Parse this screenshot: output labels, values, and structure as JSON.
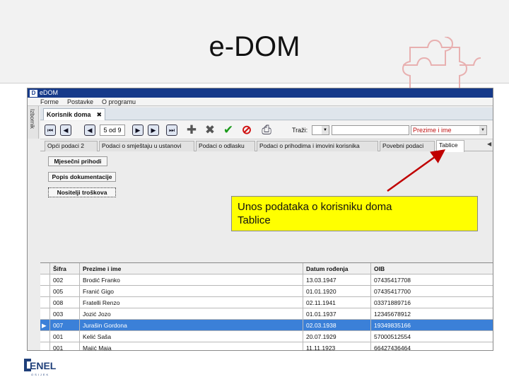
{
  "slide": {
    "title": "e-DOM"
  },
  "window": {
    "logo_letter": "D",
    "title": "eDOM"
  },
  "menu": [
    "Forme",
    "Postavke",
    "O programu"
  ],
  "left_strip_label": "Izbornik",
  "doc_tab": {
    "label": "Korisnik doma",
    "close": "✖"
  },
  "toolbar": {
    "record_counter": "5 od 9",
    "search_label": "Traži:",
    "sort_field": "Prezime i ime",
    "icons": {
      "first": "first-record-icon",
      "prev_page": "previous-page-icon",
      "prev": "previous-record-icon",
      "next": "next-record-icon",
      "next_page": "next-page-icon",
      "last": "last-record-icon",
      "add": "add-icon",
      "delete": "delete-icon",
      "save": "checkmark-icon",
      "cancel": "cancel-icon",
      "print": "printer-icon"
    },
    "glyphs": {
      "first": "⏮",
      "prev_page": "◀",
      "prev": "◀",
      "next": "▶",
      "next_page": "▶",
      "last": "⏭",
      "add": "✚",
      "delete": "✖",
      "save": "✔",
      "cancel": "⊘",
      "print": "⎙",
      "dropdown": "▼"
    }
  },
  "subtabs": [
    {
      "label": "Opći podaci 2",
      "active": false
    },
    {
      "label": "Podaci o smještaju u ustanovi",
      "active": false
    },
    {
      "label": "Podaci o odlasku",
      "active": false
    },
    {
      "label": "Podaci o prihodima i imovini korisnika",
      "active": false
    },
    {
      "label": "Povebni podaci",
      "active": false
    },
    {
      "label": "Tablice",
      "active": true
    }
  ],
  "subtab_scroll": "◀",
  "buttons": [
    {
      "label": "Mjesečni prihodi"
    },
    {
      "label": "Popis dokumentacije"
    },
    {
      "label": "Nositelji troškova"
    }
  ],
  "callout": {
    "line1": "Unos podataka o korisniku doma",
    "line2": "Tablice"
  },
  "table": {
    "columns": [
      "Šifra",
      "Prezime i ime",
      "Datum rođenja",
      "OIB"
    ],
    "selected_marker": "▶",
    "rows": [
      {
        "sifra": "002",
        "ime": "Brodić Franko",
        "datum": "13.03.1947",
        "oib": "07435417708",
        "selected": false
      },
      {
        "sifra": "005",
        "ime": "Franić Gigo",
        "datum": "01.01.1920",
        "oib": "07435417700",
        "selected": false
      },
      {
        "sifra": "008",
        "ime": "Fratelli Renzo",
        "datum": "02.11.1941",
        "oib": "03371889716",
        "selected": false
      },
      {
        "sifra": "003",
        "ime": "Jozić Jozo",
        "datum": "01.01.1937",
        "oib": "12345678912",
        "selected": false
      },
      {
        "sifra": "007",
        "ime": "Jurašin Gordona",
        "datum": "02.03.1938",
        "oib": "19349835166",
        "selected": true
      },
      {
        "sifra": "001",
        "ime": "Kelić Saša",
        "datum": "20.07.1929",
        "oib": "57000512554",
        "selected": false
      },
      {
        "sifra": "001",
        "ime": "Majić Maja",
        "datum": "11.11.1923",
        "oib": "66427436464",
        "selected": false
      }
    ]
  },
  "footer": {
    "logo_text": "ENEL",
    "logo_subtext": "OSIJEK"
  },
  "colors": {
    "titlebar": "#163a8a",
    "selected_row": "#3b80d8",
    "callout": "#ffff00",
    "arrow": "#c00000",
    "sort_field_text": "#c01010"
  }
}
